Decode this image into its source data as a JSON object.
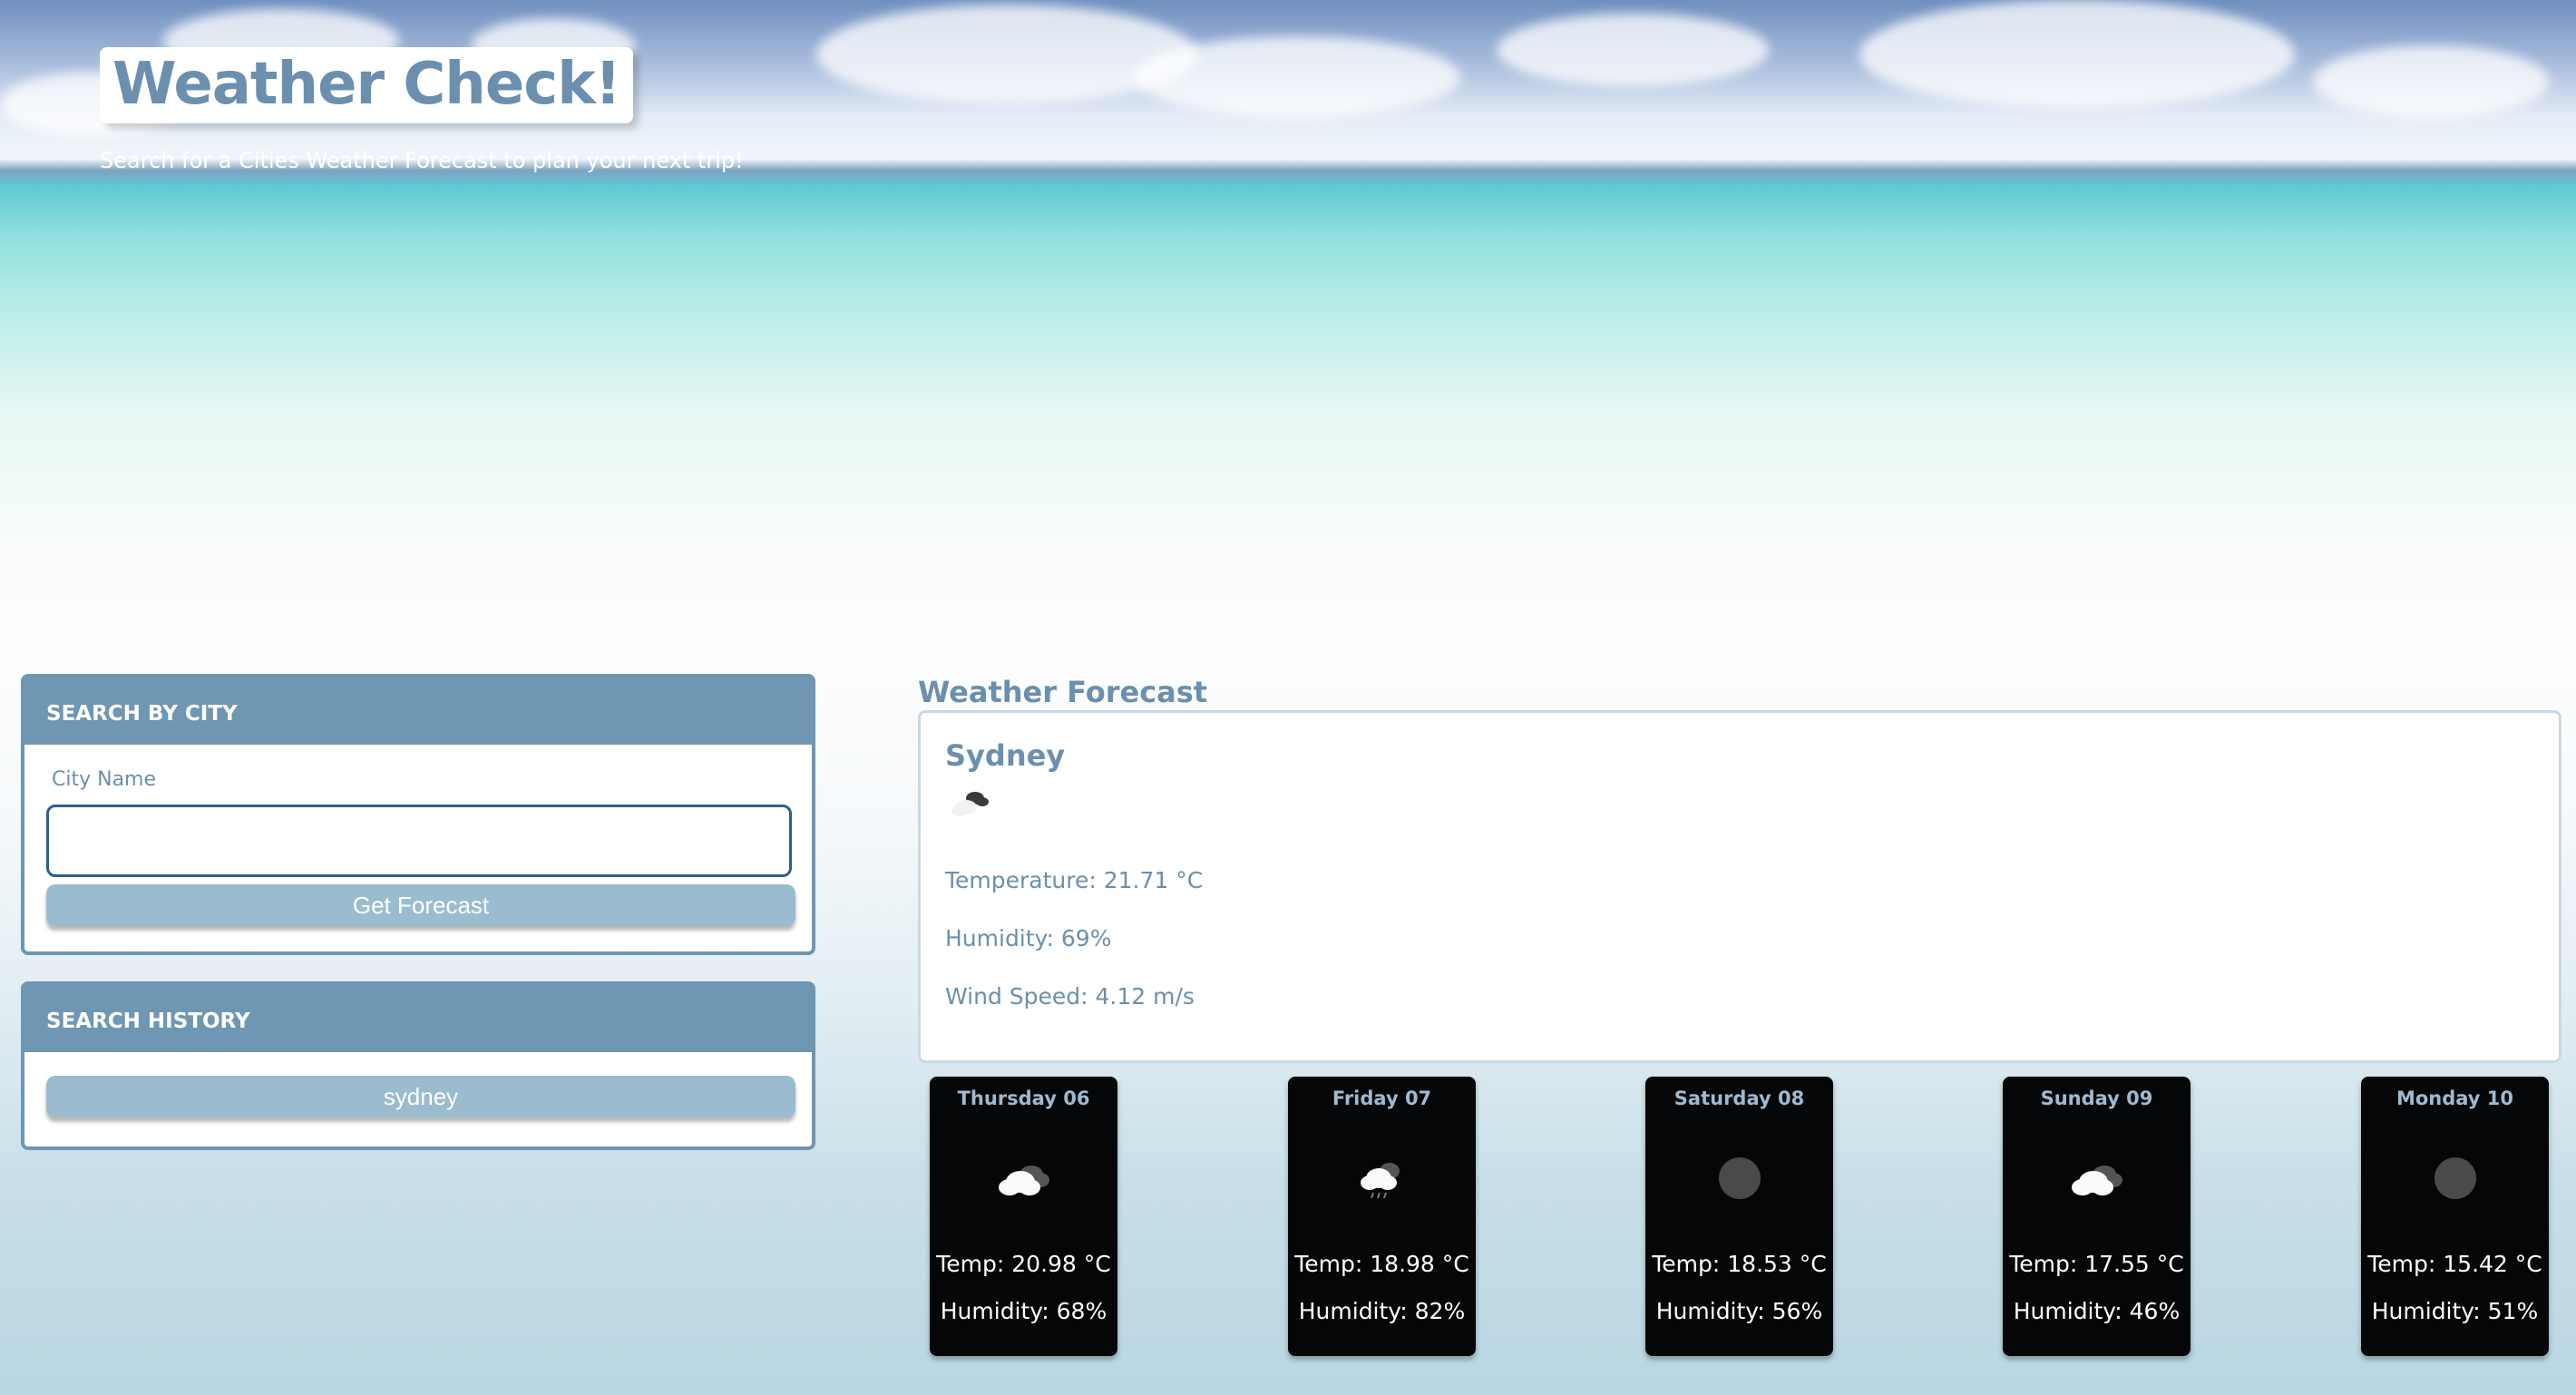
{
  "header": {
    "title": "Weather Check!",
    "subtitle": "Search for a Cities Weather Forecast to plan your next trip!"
  },
  "search": {
    "heading": "SEARCH BY CITY",
    "field_label": "City Name",
    "input_value": "",
    "button_label": "Get Forecast"
  },
  "history": {
    "heading": "SEARCH HISTORY",
    "items": [
      "sydney"
    ]
  },
  "forecast": {
    "heading": "Weather Forecast",
    "current": {
      "city": "Sydney",
      "icon": "broken-clouds-icon",
      "temperature": "Temperature: 21.71 °C",
      "humidity": "Humidity: 69%",
      "wind": "Wind Speed: 4.12 m/s"
    },
    "days": [
      {
        "label": "Thursday 06",
        "icon": "broken-clouds-icon",
        "temp": "Temp: 20.98 °C",
        "humidity": "Humidity: 68%"
      },
      {
        "label": "Friday 07",
        "icon": "rain-cloud-icon",
        "temp": "Temp: 18.98 °C",
        "humidity": "Humidity: 82%"
      },
      {
        "label": "Saturday 08",
        "icon": "clear-night-icon",
        "temp": "Temp: 18.53 °C",
        "humidity": "Humidity: 56%"
      },
      {
        "label": "Sunday 09",
        "icon": "broken-clouds-icon",
        "temp": "Temp: 17.55 °C",
        "humidity": "Humidity: 46%"
      },
      {
        "label": "Monday 10",
        "icon": "clear-night-icon",
        "temp": "Temp: 15.42 °C",
        "humidity": "Humidity: 51%"
      }
    ]
  },
  "colors": {
    "accent": "#6f96b3",
    "button": "#9bbccf",
    "text_blue": "#6b8fae",
    "card_bg": "#050607"
  }
}
